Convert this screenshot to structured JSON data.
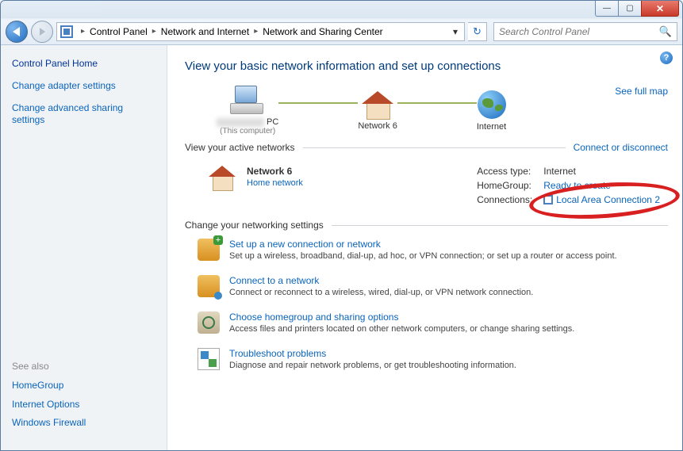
{
  "breadcrumb": {
    "items": [
      "Control Panel",
      "Network and Internet",
      "Network and Sharing Center"
    ]
  },
  "search": {
    "placeholder": "Search Control Panel"
  },
  "sidebar": {
    "home": "Control Panel Home",
    "links": [
      "Change adapter settings",
      "Change advanced sharing settings"
    ],
    "see_also_hdr": "See also",
    "see_also": [
      "HomeGroup",
      "Internet Options",
      "Windows Firewall"
    ]
  },
  "main": {
    "heading": "View your basic network information and set up connections",
    "see_full_map": "See full map",
    "map": {
      "pc_suffix": " PC",
      "pc_sub": "(This computer)",
      "network": "Network  6",
      "internet": "Internet"
    },
    "active_hdr": "View your active networks",
    "connect_disconnect": "Connect or disconnect",
    "active": {
      "name": "Network  6",
      "type": "Home network",
      "access_k": "Access type:",
      "access_v": "Internet",
      "hg_k": "HomeGroup:",
      "hg_v": "Ready to create",
      "conn_k": "Connections:",
      "conn_v": "Local Area Connection 2"
    },
    "change_hdr": "Change your networking settings",
    "settings": [
      {
        "title": "Set up a new connection or network",
        "desc": "Set up a wireless, broadband, dial-up, ad hoc, or VPN connection; or set up a router or access point."
      },
      {
        "title": "Connect to a network",
        "desc": "Connect or reconnect to a wireless, wired, dial-up, or VPN network connection."
      },
      {
        "title": "Choose homegroup and sharing options",
        "desc": "Access files and printers located on other network computers, or change sharing settings."
      },
      {
        "title": "Troubleshoot problems",
        "desc": "Diagnose and repair network problems, or get troubleshooting information."
      }
    ]
  }
}
